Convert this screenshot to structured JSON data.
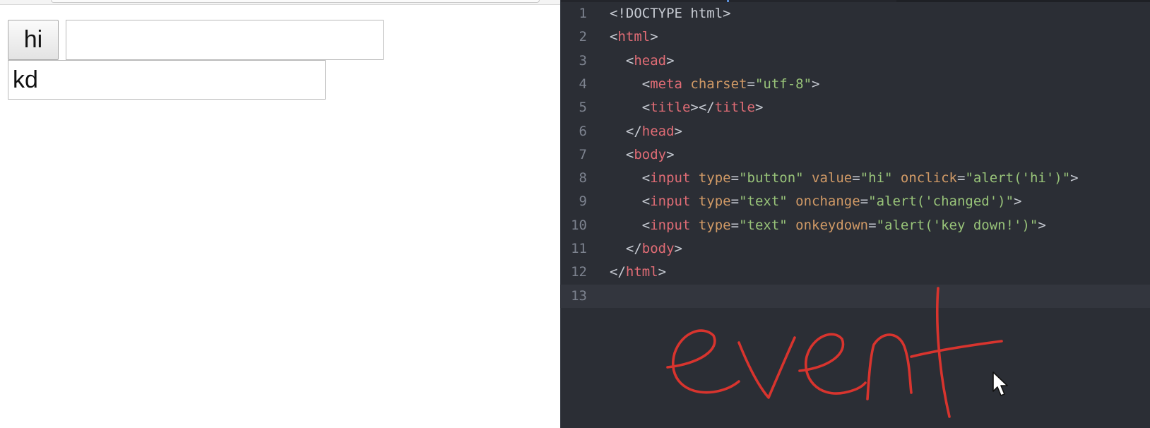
{
  "browser": {
    "button_value": "hi",
    "change_input_value": "",
    "keydown_input_value": "kd"
  },
  "editor": {
    "lines": [
      {
        "num": "1",
        "tokens": [
          [
            "p",
            "<!DOCTYPE html>"
          ]
        ]
      },
      {
        "num": "2",
        "tokens": [
          [
            "p",
            "<"
          ],
          [
            "t",
            "html"
          ],
          [
            "p",
            ">"
          ]
        ]
      },
      {
        "num": "3",
        "tokens": [
          [
            "p",
            "  <"
          ],
          [
            "t",
            "head"
          ],
          [
            "p",
            ">"
          ]
        ]
      },
      {
        "num": "4",
        "tokens": [
          [
            "p",
            "    <"
          ],
          [
            "t",
            "meta"
          ],
          [
            "p",
            " "
          ],
          [
            "a",
            "charset"
          ],
          [
            "p",
            "="
          ],
          [
            "s",
            "\"utf-8\""
          ],
          [
            "p",
            ">"
          ]
        ]
      },
      {
        "num": "5",
        "tokens": [
          [
            "p",
            "    <"
          ],
          [
            "t",
            "title"
          ],
          [
            "p",
            "></"
          ],
          [
            "t",
            "title"
          ],
          [
            "p",
            ">"
          ]
        ]
      },
      {
        "num": "6",
        "tokens": [
          [
            "p",
            "  </"
          ],
          [
            "t",
            "head"
          ],
          [
            "p",
            ">"
          ]
        ]
      },
      {
        "num": "7",
        "tokens": [
          [
            "p",
            "  <"
          ],
          [
            "t",
            "body"
          ],
          [
            "p",
            ">"
          ]
        ]
      },
      {
        "num": "8",
        "tokens": [
          [
            "p",
            "    <"
          ],
          [
            "t",
            "input"
          ],
          [
            "p",
            " "
          ],
          [
            "a",
            "type"
          ],
          [
            "p",
            "="
          ],
          [
            "s",
            "\"button\""
          ],
          [
            "p",
            " "
          ],
          [
            "a",
            "value"
          ],
          [
            "p",
            "="
          ],
          [
            "s",
            "\"hi\""
          ],
          [
            "p",
            " "
          ],
          [
            "a",
            "onclick"
          ],
          [
            "p",
            "="
          ],
          [
            "s",
            "\"alert('hi')\""
          ],
          [
            "p",
            ">"
          ]
        ]
      },
      {
        "num": "9",
        "tokens": [
          [
            "p",
            "    <"
          ],
          [
            "t",
            "input"
          ],
          [
            "p",
            " "
          ],
          [
            "a",
            "type"
          ],
          [
            "p",
            "="
          ],
          [
            "s",
            "\"text\""
          ],
          [
            "p",
            " "
          ],
          [
            "a",
            "onchange"
          ],
          [
            "p",
            "="
          ],
          [
            "s",
            "\"alert('changed')\""
          ],
          [
            "p",
            ">"
          ]
        ]
      },
      {
        "num": "10",
        "tokens": [
          [
            "p",
            "    <"
          ],
          [
            "t",
            "input"
          ],
          [
            "p",
            " "
          ],
          [
            "a",
            "type"
          ],
          [
            "p",
            "="
          ],
          [
            "s",
            "\"text\""
          ],
          [
            "p",
            " "
          ],
          [
            "a",
            "onkeydown"
          ],
          [
            "p",
            "="
          ],
          [
            "s",
            "\"alert('key down!')\""
          ],
          [
            "p",
            ">"
          ]
        ]
      },
      {
        "num": "11",
        "tokens": [
          [
            "p",
            "  </"
          ],
          [
            "t",
            "body"
          ],
          [
            "p",
            ">"
          ]
        ]
      },
      {
        "num": "12",
        "tokens": [
          [
            "p",
            "</"
          ],
          [
            "t",
            "html"
          ],
          [
            "p",
            ">"
          ]
        ]
      },
      {
        "num": "13",
        "tokens": []
      }
    ],
    "active_line": "13",
    "annotation_word": "event",
    "cursor_icon": "mouse-pointer-icon"
  },
  "colors": {
    "editor_bg": "#2b2e35",
    "tag": "#e06c75",
    "attribute": "#d19a66",
    "string": "#98c379",
    "ink": "#d8342e"
  }
}
